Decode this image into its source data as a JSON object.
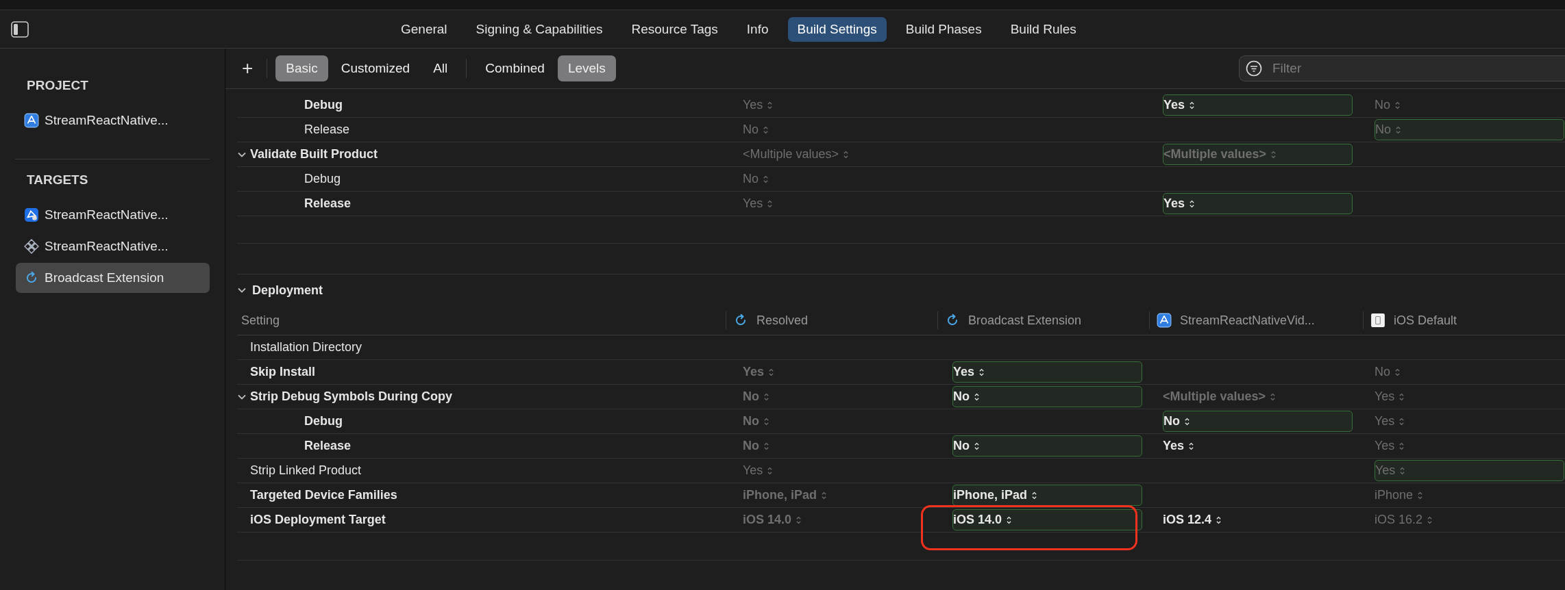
{
  "tabs": [
    {
      "label": "General",
      "selected": false
    },
    {
      "label": "Signing & Capabilities",
      "selected": false
    },
    {
      "label": "Resource Tags",
      "selected": false
    },
    {
      "label": "Info",
      "selected": false
    },
    {
      "label": "Build Settings",
      "selected": true
    },
    {
      "label": "Build Phases",
      "selected": false
    },
    {
      "label": "Build Rules",
      "selected": false
    }
  ],
  "sidebar": {
    "groups": [
      {
        "title": "PROJECT",
        "items": [
          {
            "label": "StreamReactNative...",
            "selected": false
          }
        ]
      },
      {
        "title": "TARGETS",
        "items": [
          {
            "label": "StreamReactNative...",
            "selected": false
          },
          {
            "label": "StreamReactNative...",
            "selected": false
          },
          {
            "label": "Broadcast Extension",
            "selected": true
          }
        ]
      }
    ]
  },
  "toolbar": {
    "add": "+",
    "scope": [
      {
        "label": "Basic",
        "selected": true
      },
      {
        "label": "Customized",
        "selected": false
      },
      {
        "label": "All",
        "selected": false
      }
    ],
    "view": [
      {
        "label": "Combined",
        "selected": false
      },
      {
        "label": "Levels",
        "selected": true
      }
    ],
    "filter": {
      "placeholder": "Filter"
    }
  },
  "sections": [
    {
      "rows": [
        {
          "children": [
            {
              "name": "Debug",
              "bold": true,
              "cells": [
                {
                  "value": "Yes",
                  "bold": false,
                  "dim": true,
                  "boxed": false,
                  "circled": false
                },
                null,
                {
                  "value": "Yes",
                  "bold": true,
                  "dim": false,
                  "boxed": true,
                  "circled": false
                },
                {
                  "value": "No",
                  "bold": false,
                  "dim": true,
                  "boxed": false,
                  "circled": false
                }
              ]
            },
            {
              "name": "Release",
              "bold": false,
              "cells": [
                {
                  "value": "No",
                  "bold": false,
                  "dim": true,
                  "boxed": false,
                  "circled": false
                },
                null,
                null,
                {
                  "value": "No",
                  "bold": false,
                  "dim": true,
                  "boxed": true,
                  "circled": false
                }
              ]
            }
          ]
        },
        {
          "name": "Validate Built Product",
          "bold": true,
          "expanded": true,
          "cells": [
            {
              "value": "<Multiple values>",
              "bold": false,
              "dim": true,
              "boxed": false,
              "circled": false
            },
            null,
            {
              "value": "<Multiple values>",
              "bold": true,
              "dim": true,
              "boxed": true,
              "circled": false
            },
            null
          ],
          "children": [
            {
              "name": "Debug",
              "bold": false,
              "cells": [
                {
                  "value": "No",
                  "bold": false,
                  "dim": true,
                  "boxed": false,
                  "circled": false
                },
                null,
                null,
                null
              ]
            },
            {
              "name": "Release",
              "bold": true,
              "cells": [
                {
                  "value": "Yes",
                  "bold": false,
                  "dim": true,
                  "boxed": false,
                  "circled": false
                },
                null,
                {
                  "value": "Yes",
                  "bold": true,
                  "dim": false,
                  "boxed": true,
                  "circled": false
                },
                null
              ]
            }
          ]
        }
      ]
    },
    {
      "title": "Deployment",
      "expanded": true,
      "setting_header": "Setting",
      "columns": [
        {
          "label": "Resolved"
        },
        {
          "label": "Broadcast Extension"
        },
        {
          "label": "StreamReactNativeVid..."
        },
        {
          "label": "iOS Default"
        }
      ],
      "rows": [
        {
          "name": "Installation Directory",
          "bold": false,
          "cells": [
            null,
            null,
            null,
            null
          ]
        },
        {
          "name": "Skip Install",
          "bold": true,
          "cells": [
            {
              "value": "Yes",
              "bold": true,
              "dim": true,
              "boxed": false,
              "circled": false
            },
            {
              "value": "Yes",
              "bold": true,
              "dim": false,
              "boxed": true,
              "circled": false
            },
            null,
            {
              "value": "No",
              "bold": false,
              "dim": true,
              "boxed": false,
              "circled": false
            }
          ]
        },
        {
          "name": "Strip Debug Symbols During Copy",
          "bold": true,
          "expanded": true,
          "cells": [
            {
              "value": "No",
              "bold": true,
              "dim": true,
              "boxed": false,
              "circled": false
            },
            {
              "value": "No",
              "bold": true,
              "dim": false,
              "boxed": true,
              "circled": false
            },
            {
              "value": "<Multiple values>",
              "bold": true,
              "dim": true,
              "boxed": false,
              "circled": false
            },
            {
              "value": "Yes",
              "bold": false,
              "dim": true,
              "boxed": false,
              "circled": false
            }
          ],
          "children": [
            {
              "name": "Debug",
              "bold": true,
              "cells": [
                {
                  "value": "No",
                  "bold": true,
                  "dim": true,
                  "boxed": false,
                  "circled": false
                },
                null,
                {
                  "value": "No",
                  "bold": true,
                  "dim": false,
                  "boxed": true,
                  "circled": false
                },
                {
                  "value": "Yes",
                  "bold": false,
                  "dim": true,
                  "boxed": false,
                  "circled": false
                }
              ]
            },
            {
              "name": "Release",
              "bold": true,
              "cells": [
                {
                  "value": "No",
                  "bold": true,
                  "dim": true,
                  "boxed": false,
                  "circled": false
                },
                {
                  "value": "No",
                  "bold": true,
                  "dim": false,
                  "boxed": true,
                  "circled": false
                },
                {
                  "value": "Yes",
                  "bold": true,
                  "dim": false,
                  "boxed": false,
                  "circled": false
                },
                {
                  "value": "Yes",
                  "bold": false,
                  "dim": true,
                  "boxed": false,
                  "circled": false
                }
              ]
            }
          ]
        },
        {
          "name": "Strip Linked Product",
          "bold": false,
          "cells": [
            {
              "value": "Yes",
              "bold": false,
              "dim": true,
              "boxed": false,
              "circled": false
            },
            null,
            null,
            {
              "value": "Yes",
              "bold": false,
              "dim": true,
              "boxed": true,
              "circled": false
            }
          ]
        },
        {
          "name": "Targeted Device Families",
          "bold": true,
          "cells": [
            {
              "value": "iPhone, iPad",
              "bold": true,
              "dim": true,
              "boxed": false,
              "circled": false
            },
            {
              "value": "iPhone, iPad",
              "bold": true,
              "dim": false,
              "boxed": true,
              "circled": false
            },
            null,
            {
              "value": "iPhone",
              "bold": false,
              "dim": true,
              "boxed": false,
              "circled": false
            }
          ]
        },
        {
          "name": "iOS Deployment Target",
          "bold": true,
          "cells": [
            {
              "value": "iOS 14.0",
              "bold": true,
              "dim": true,
              "boxed": false,
              "circled": false
            },
            {
              "value": "iOS 14.0",
              "bold": true,
              "dim": false,
              "boxed": true,
              "circled": true
            },
            {
              "value": "iOS 12.4",
              "bold": true,
              "dim": false,
              "boxed": false,
              "circled": false
            },
            {
              "value": "iOS 16.2",
              "bold": false,
              "dim": true,
              "boxed": false,
              "circled": false
            }
          ]
        }
      ]
    }
  ]
}
